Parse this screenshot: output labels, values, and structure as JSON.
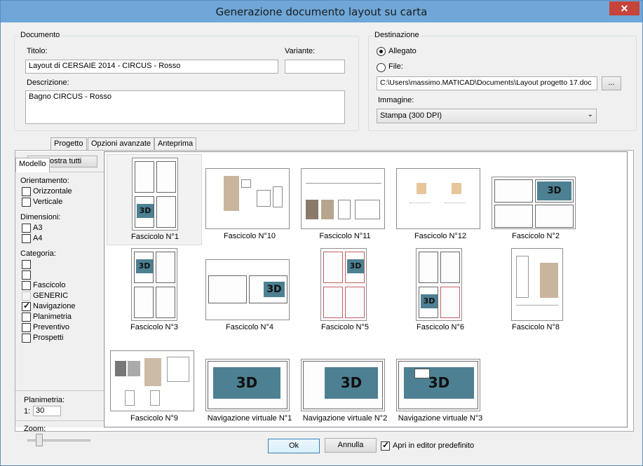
{
  "window": {
    "title": "Generazione documento layout su carta",
    "close_glyph": "✕"
  },
  "documento": {
    "group_label": "Documento",
    "titolo_label": "Titolo:",
    "titolo_value": "Layout di CERSAIE 2014 - CIRCUS - Rosso",
    "variante_label": "Variante:",
    "variante_value": "",
    "descrizione_label": "Descrizione:",
    "descrizione_value": "Bagno CIRCUS - Rosso"
  },
  "destinazione": {
    "group_label": "Destinazione",
    "allegato_label": "Allegato",
    "file_label": "File:",
    "file_path": "C:\\Users\\massimo.MATICAD\\Documents\\Layout progetto 17.doc",
    "browse_label": "...",
    "immagine_label": "Immagine:",
    "immagine_value": "Stampa (300 DPI)"
  },
  "tabs": [
    "Modello",
    "Progetto",
    "Opzioni avanzate",
    "Anteprima"
  ],
  "filters": {
    "show_all": "Mostra tutti",
    "orientamento_label": "Orientamento:",
    "orientamento": [
      "Orizzontale",
      "Verticale"
    ],
    "dimensioni_label": "Dimensioni:",
    "dimensioni": [
      "A3",
      "A4"
    ],
    "categoria_label": "Categoria:",
    "categoria": [
      "",
      "",
      "Fascicolo",
      "GENERIC",
      "Navigazione",
      "Planimetria",
      "Preventivo",
      "Prospetti"
    ],
    "planimetria_label": "Planimetria:",
    "scale_prefix": "1:",
    "scale_value": "30",
    "zoom_label": "Zoom:",
    "zoom_level": 0.15
  },
  "templates": [
    "Fascicolo N°1",
    "Fascicolo N°10",
    "Fascicolo N°11",
    "Fascicolo N°12",
    "Fascicolo N°2",
    "Fascicolo N°3",
    "Fascicolo N°4",
    "Fascicolo N°5",
    "Fascicolo N°6",
    "Fascicolo N°8",
    "Fascicolo N°9",
    "Navigazione virtuale N°1",
    "Navigazione virtuale N°2",
    "Navigazione virtuale N°3"
  ],
  "thumb_3d": "3D",
  "footer": {
    "ok": "Ok",
    "annulla": "Annulla",
    "apri_editor": "Apri in editor predefinito"
  }
}
